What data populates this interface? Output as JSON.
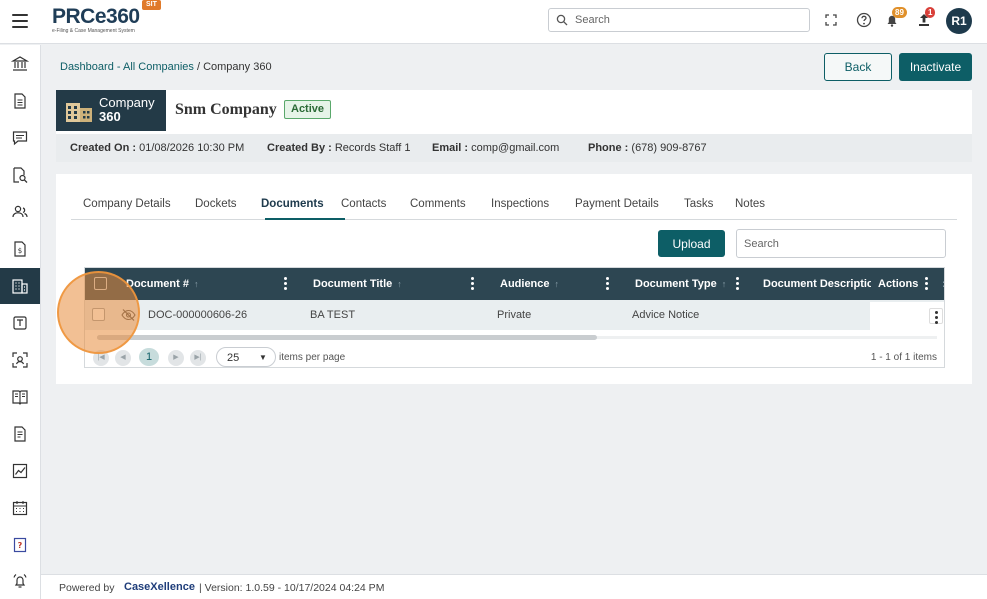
{
  "header": {
    "logo_text": "PRCe360",
    "logo_subtitle": "e-Filing & Case Management System",
    "env_badge": "SIT",
    "search_placeholder": "Search",
    "notification_count": "89",
    "upload_count": "1",
    "avatar_initials": "R1",
    "colors": {
      "accent": "#0d5e66",
      "dark": "#233a47",
      "notif": "#e0902a",
      "alert": "#d9403a"
    }
  },
  "sidebar": {
    "items": [
      {
        "icon": "bank-icon"
      },
      {
        "icon": "document-icon"
      },
      {
        "icon": "chat-icon"
      },
      {
        "icon": "document-search-icon"
      },
      {
        "icon": "users-icon"
      },
      {
        "icon": "fee-document-icon"
      },
      {
        "icon": "company-building-icon",
        "active": true
      },
      {
        "icon": "tablet-icon"
      },
      {
        "icon": "scan-user-icon"
      },
      {
        "icon": "book-icon"
      },
      {
        "icon": "report-icon"
      },
      {
        "icon": "chart-icon"
      },
      {
        "icon": "calendar-icon"
      },
      {
        "icon": "help-book-icon"
      },
      {
        "icon": "alarm-icon"
      }
    ]
  },
  "breadcrumb": {
    "link": "Dashboard - All Companies",
    "separator": " / ",
    "current": "Company 360"
  },
  "actions": {
    "back": "Back",
    "inactivate": "Inactivate"
  },
  "company": {
    "tile_line1": "Company",
    "tile_line2": "360",
    "name": "Snm Company",
    "status": "Active",
    "created_on_label": "Created On :",
    "created_on": "01/08/2026 10:30 PM",
    "created_by_label": "Created By :",
    "created_by": "Records Staff 1",
    "email_label": "Email :",
    "email": "comp@gmail.com",
    "phone_label": "Phone :",
    "phone": "(678) 909-8767"
  },
  "tabs": [
    {
      "label": "Company Details"
    },
    {
      "label": "Dockets"
    },
    {
      "label": "Documents",
      "active": true
    },
    {
      "label": "Contacts"
    },
    {
      "label": "Comments"
    },
    {
      "label": "Inspections"
    },
    {
      "label": "Payment Details"
    },
    {
      "label": "Tasks"
    },
    {
      "label": "Notes"
    }
  ],
  "documents": {
    "upload_label": "Upload",
    "search_placeholder": "Search",
    "columns": [
      "Document #",
      "Document Title",
      "Audience",
      "Document Type",
      "Document Descriptio",
      "Actions"
    ],
    "rows": [
      {
        "number": "DOC-000000606-26",
        "title": "BA TEST",
        "audience": "Private",
        "type": "Advice Notice",
        "description": ""
      }
    ],
    "pager": {
      "page": "1",
      "page_size": "25",
      "items_per_page_label": "items per page",
      "range": "1 - 1 of 1 items"
    }
  },
  "footer": {
    "powered_by": "Powered by",
    "brand": "CaseXellence",
    "version": "|   Version: 1.0.59 - 10/17/2024 04:24 PM"
  }
}
